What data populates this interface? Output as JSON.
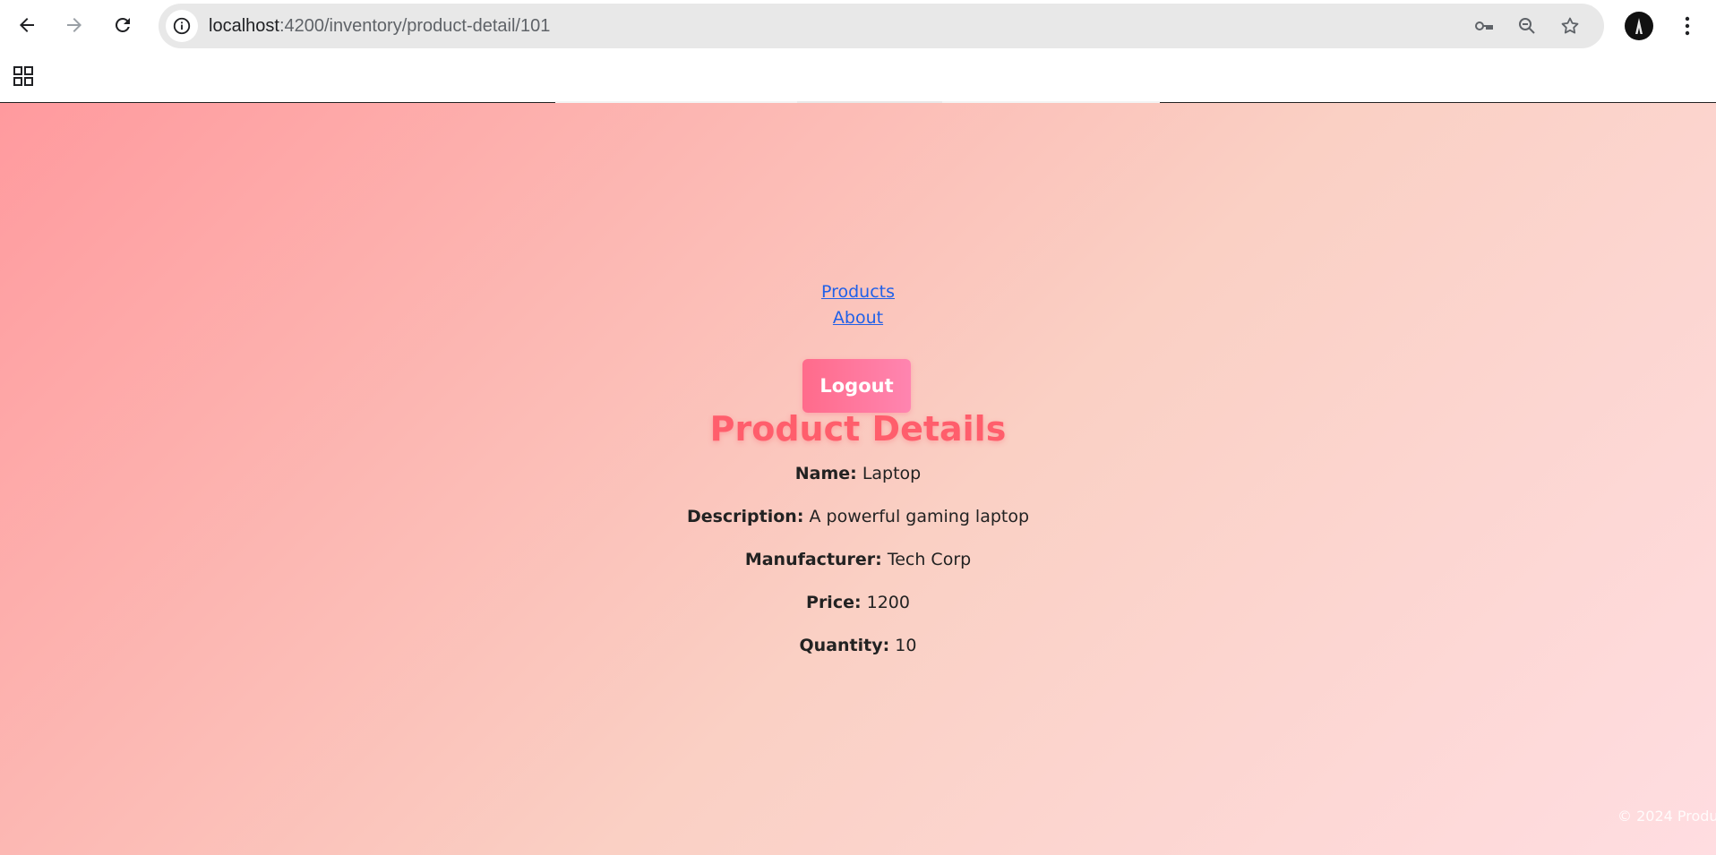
{
  "browser": {
    "url_host": "localhost",
    "url_path": ":4200/inventory/product-detail/101"
  },
  "nav": {
    "links": [
      "Products",
      "About"
    ],
    "logout_label": "Logout"
  },
  "page": {
    "title": "Product Details",
    "fields": [
      {
        "label": "Name:",
        "value": "Laptop"
      },
      {
        "label": "Description:",
        "value": "A powerful gaming laptop"
      },
      {
        "label": "Manufacturer:",
        "value": "Tech Corp"
      },
      {
        "label": "Price:",
        "value": "1200"
      },
      {
        "label": "Quantity:",
        "value": "10"
      }
    ]
  },
  "footer": {
    "text": "© 2024 Produ"
  }
}
